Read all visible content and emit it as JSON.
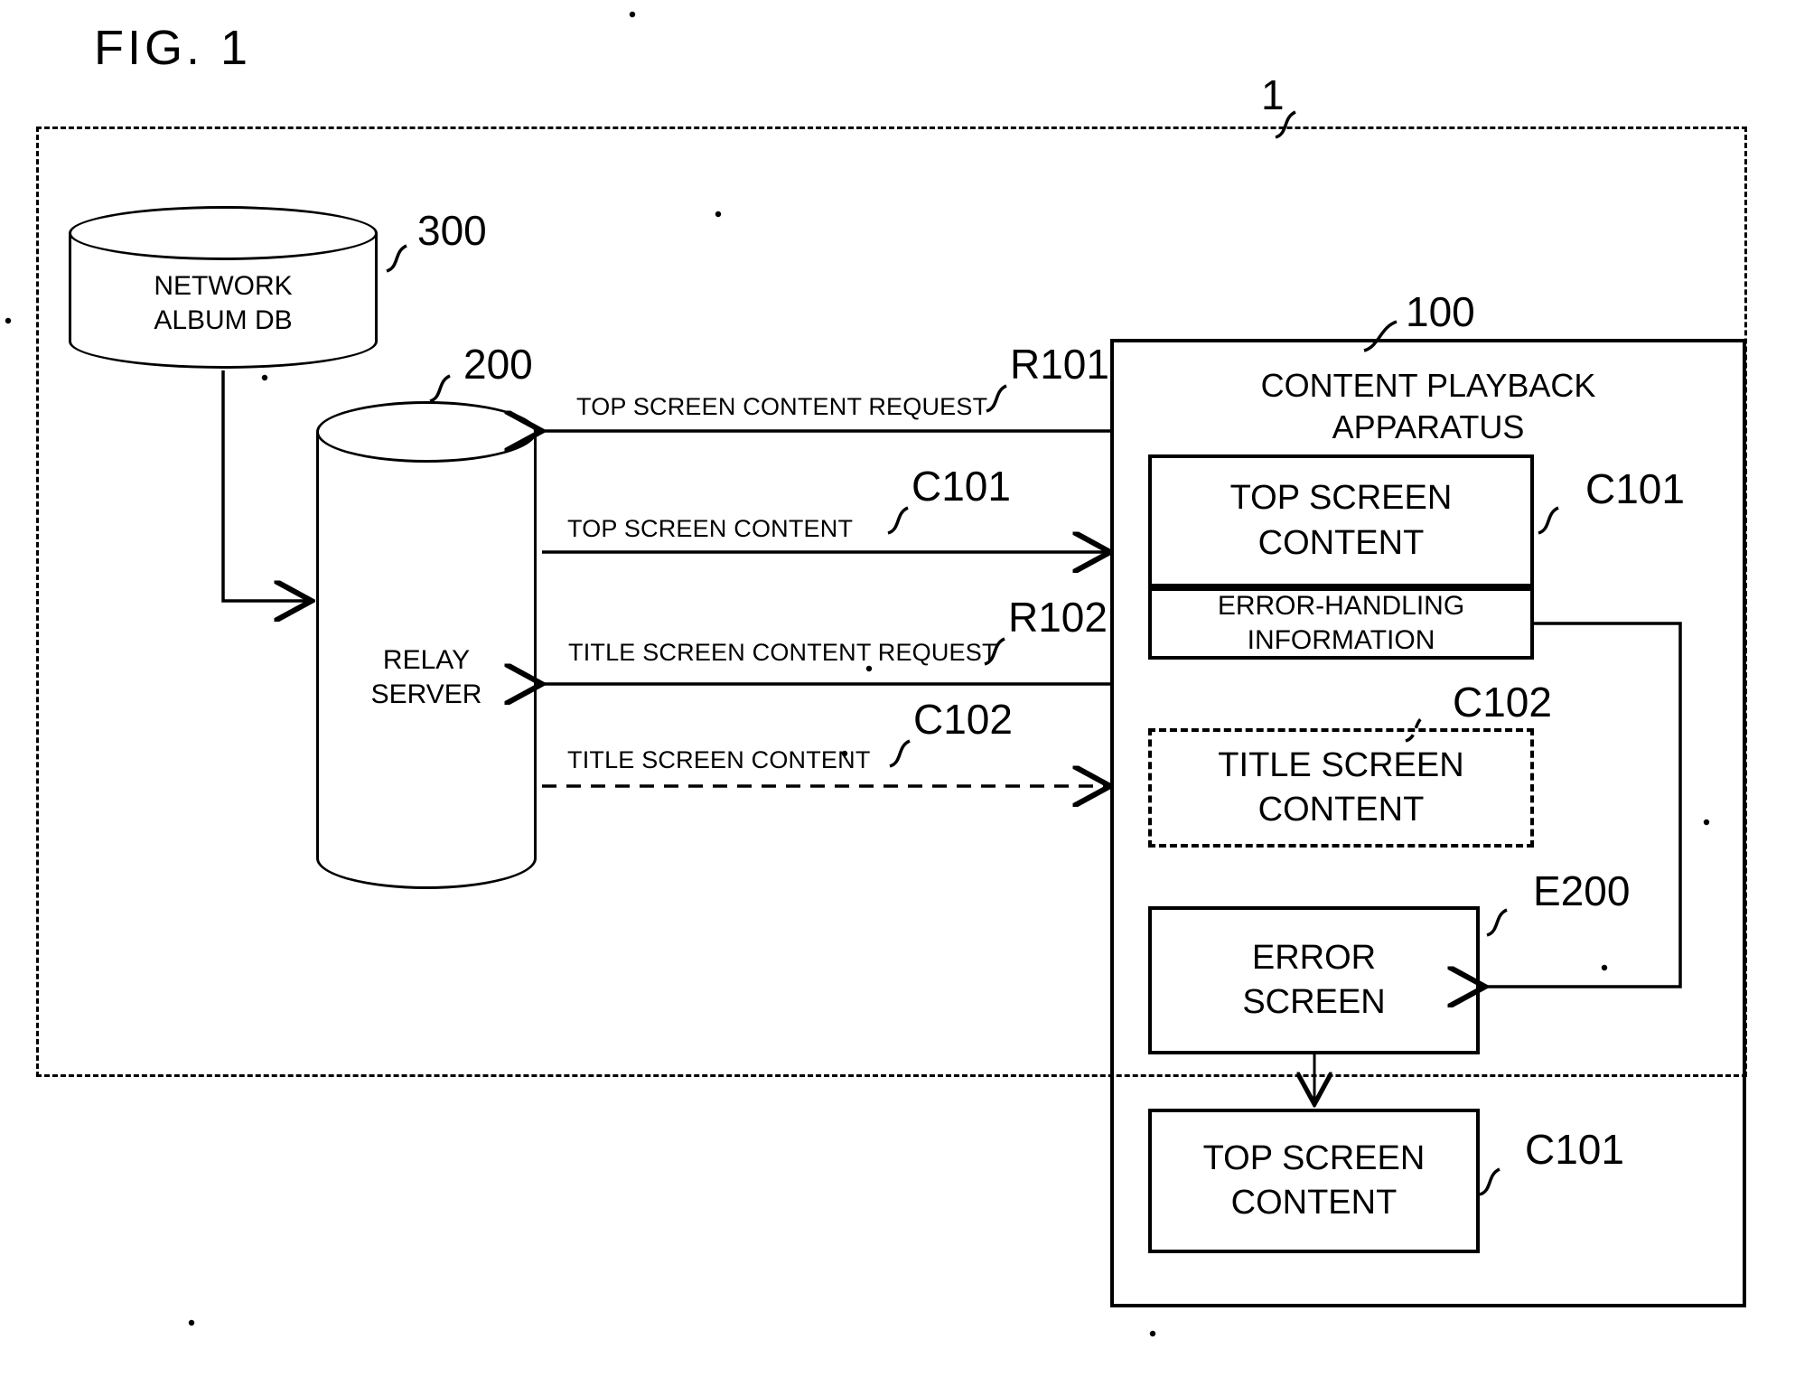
{
  "figure": {
    "title": "FIG. 1",
    "system_ref": "1"
  },
  "nodes": {
    "network_album_db": {
      "label_line1": "NETWORK",
      "label_line2": "ALBUM DB",
      "ref": "300"
    },
    "relay_server": {
      "label_line1": "RELAY",
      "label_line2": "SERVER",
      "ref": "200"
    },
    "content_playback_apparatus": {
      "label_line1": "CONTENT PLAYBACK",
      "label_line2": "APPARATUS",
      "ref": "100"
    },
    "top_screen_content_1": {
      "label_line1": "TOP SCREEN",
      "label_line2": "CONTENT",
      "ref": "C101"
    },
    "error_handling_information": {
      "label_line1": "ERROR-HANDLING",
      "label_line2": "INFORMATION"
    },
    "title_screen_content": {
      "label_line1": "TITLE SCREEN",
      "label_line2": "CONTENT",
      "ref": "C102"
    },
    "error_screen": {
      "label_line1": "ERROR",
      "label_line2": "SCREEN",
      "ref": "E200"
    },
    "top_screen_content_2": {
      "label_line1": "TOP SCREEN",
      "label_line2": "CONTENT",
      "ref": "C101"
    }
  },
  "flows": [
    {
      "id": "r101",
      "label": "TOP SCREEN CONTENT REQUEST",
      "ref": "R101",
      "direction": "apparatus-to-relay",
      "style": "solid"
    },
    {
      "id": "c101",
      "label": "TOP SCREEN CONTENT",
      "ref": "C101",
      "direction": "relay-to-apparatus",
      "style": "solid"
    },
    {
      "id": "r102",
      "label": "TITLE SCREEN CONTENT REQUEST",
      "ref": "R102",
      "direction": "apparatus-to-relay",
      "style": "solid"
    },
    {
      "id": "c102",
      "label": "TITLE SCREEN CONTENT",
      "ref": "C102",
      "direction": "relay-to-apparatus",
      "style": "dashed"
    }
  ],
  "colors": {
    "ink": "#000000",
    "paper": "#ffffff"
  }
}
